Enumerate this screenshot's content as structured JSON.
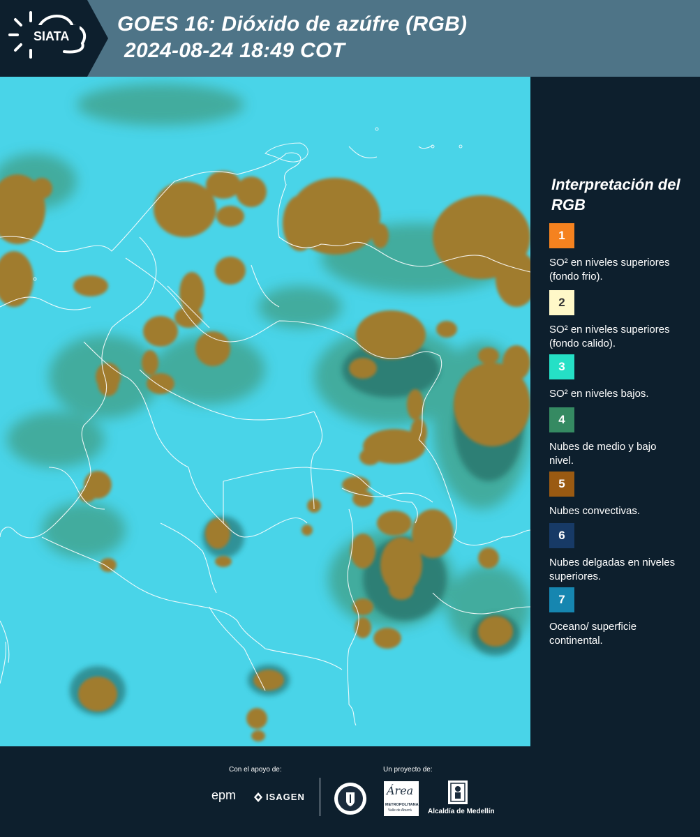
{
  "header": {
    "logo_text": "SIATA",
    "title_line1": "GOES 16: Dióxido de azúfre (RGB)",
    "title_line2": "2024-08-24 18:49 COT"
  },
  "legend": {
    "title": "Interpretación del RGB",
    "items": [
      {
        "num": "1",
        "color": "#f5821f",
        "text": "SO² en niveles superiores (fondo frio)."
      },
      {
        "num": "2",
        "color": "#fff8c8",
        "text": "SO² en niveles superiores (fondo calido)."
      },
      {
        "num": "3",
        "color": "#25e0c6",
        "text": "SO² en niveles bajos."
      },
      {
        "num": "4",
        "color": "#358a62",
        "text": "Nubes de medio y bajo nivel."
      },
      {
        "num": "5",
        "color": "#9a5a12",
        "text": "Nubes convectivas."
      },
      {
        "num": "6",
        "color": "#173a66",
        "text": "Nubes delgadas en niveles superiores."
      },
      {
        "num": "7",
        "color": "#1686b0",
        "text": "Oceano/ superficie continental."
      }
    ]
  },
  "footer": {
    "support_label": "Con el apoyo de:",
    "project_label": "Un proyecto de:",
    "epm": "epm",
    "isagen": "ISAGEN",
    "area_script": "Área",
    "area_sub": "METROPOLITANA",
    "area_sub2": "Valle de Aburrá",
    "alcaldia": "Alcaldía de Medellín"
  },
  "colors": {
    "header_bg": "#4e7487",
    "page_bg": "#0d1f2d",
    "surface_cyan": "#3fd1e6",
    "convective_brown": "#9a7a2e",
    "midlevel_green": "#3c9a74"
  }
}
